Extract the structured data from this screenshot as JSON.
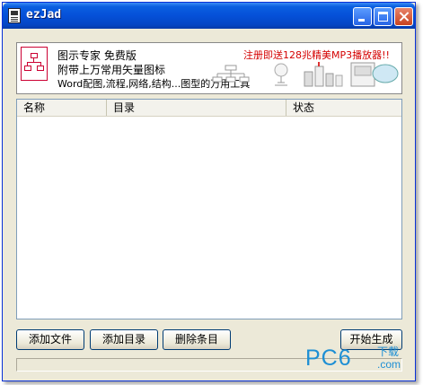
{
  "window": {
    "title": "ezJad",
    "app_icon": "document-icon",
    "controls": [
      "minimize",
      "maximize",
      "close"
    ]
  },
  "banner": {
    "line1": "图示专家 免费版",
    "line2": "附带上万常用矢量图标",
    "line3": "Word配图,流程,网络,结构...图型的万用工具",
    "promo": "注册即送128兆精美MP3播放器!!",
    "promo_color": "#d40000"
  },
  "list": {
    "columns": [
      "名称",
      "目录",
      "状态"
    ],
    "rows": []
  },
  "buttons": {
    "add_file": "添加文件",
    "add_dir": "添加目录",
    "delete_item": "删除条目",
    "start": "开始生成"
  },
  "watermark": {
    "text": "PC6",
    "sub": "下载",
    "domain": ".com",
    "color": "#1e8fd4"
  },
  "colors": {
    "titlebar": "#0550d8",
    "window_bg": "#ece9d8",
    "close_button": "#c9431f"
  }
}
